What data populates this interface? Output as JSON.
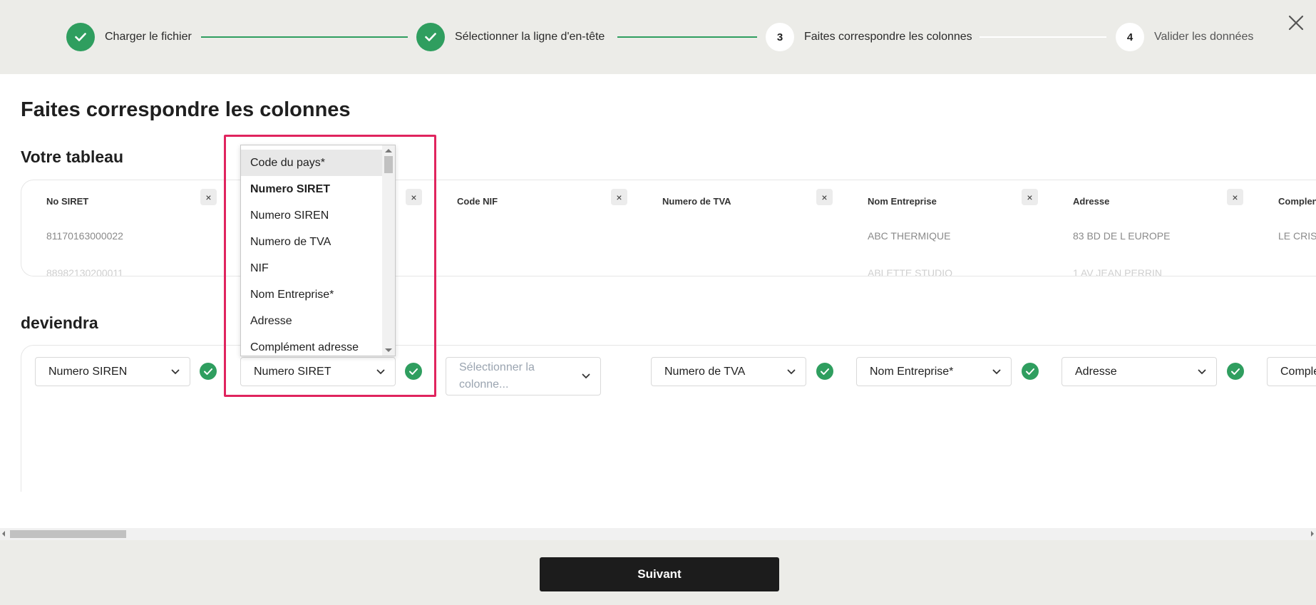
{
  "stepper": {
    "steps": [
      {
        "label": "Charger le fichier",
        "number": "",
        "status": "done"
      },
      {
        "label": "Sélectionner la ligne d'en-tête",
        "number": "",
        "status": "done"
      },
      {
        "label": "Faites correspondre les colonnes",
        "number": "3",
        "status": "current"
      },
      {
        "label": "Valider les données",
        "number": "4",
        "status": "todo"
      }
    ],
    "close_icon": "close-icon"
  },
  "page_title": "Faites correspondre les colonnes",
  "table_section": {
    "title": "Votre tableau",
    "columns": [
      {
        "header": "No SIRET",
        "rows": [
          "81170163000022",
          "88982130200011"
        ]
      },
      {
        "header": "",
        "rows": [
          "",
          ""
        ]
      },
      {
        "header": "Code NIF",
        "rows": [
          "",
          ""
        ]
      },
      {
        "header": "Numero de TVA",
        "rows": [
          "",
          ""
        ]
      },
      {
        "header": "Nom Entreprise",
        "rows": [
          "ABC THERMIQUE",
          "ABLETTE STUDIO"
        ]
      },
      {
        "header": "Adresse",
        "rows": [
          "83 BD DE L EUROPE",
          "1 AV JEAN PERRIN"
        ]
      },
      {
        "header": "Complen",
        "rows": [
          "LE CRIST",
          ""
        ]
      }
    ]
  },
  "mapping_section": {
    "title": "deviendra",
    "selects": [
      {
        "value": "Numero SIREN",
        "matched": true
      },
      {
        "value": "Numero SIRET",
        "matched": true
      },
      {
        "value": "Sélectionner la colonne...",
        "matched": false
      },
      {
        "value": "Numero de TVA",
        "matched": true
      },
      {
        "value": "Nom Entreprise*",
        "matched": true
      },
      {
        "value": "Adresse",
        "matched": true
      },
      {
        "value": "Comple",
        "matched": false
      }
    ]
  },
  "dropdown": {
    "options": [
      "Code du pays*",
      "Numero SIRET",
      "Numero SIREN",
      "Numero de TVA",
      "NIF",
      "Nom Entreprise*",
      "Adresse",
      "Complément adresse"
    ],
    "highlighted_index": 0,
    "current_index": 1
  },
  "footer": {
    "next_label": "Suivant"
  },
  "colors": {
    "accent_green": "#2f9e5f",
    "highlight_pink": "#e0245e",
    "header_bg": "#ecece8",
    "button_dark": "#1c1c1c"
  }
}
